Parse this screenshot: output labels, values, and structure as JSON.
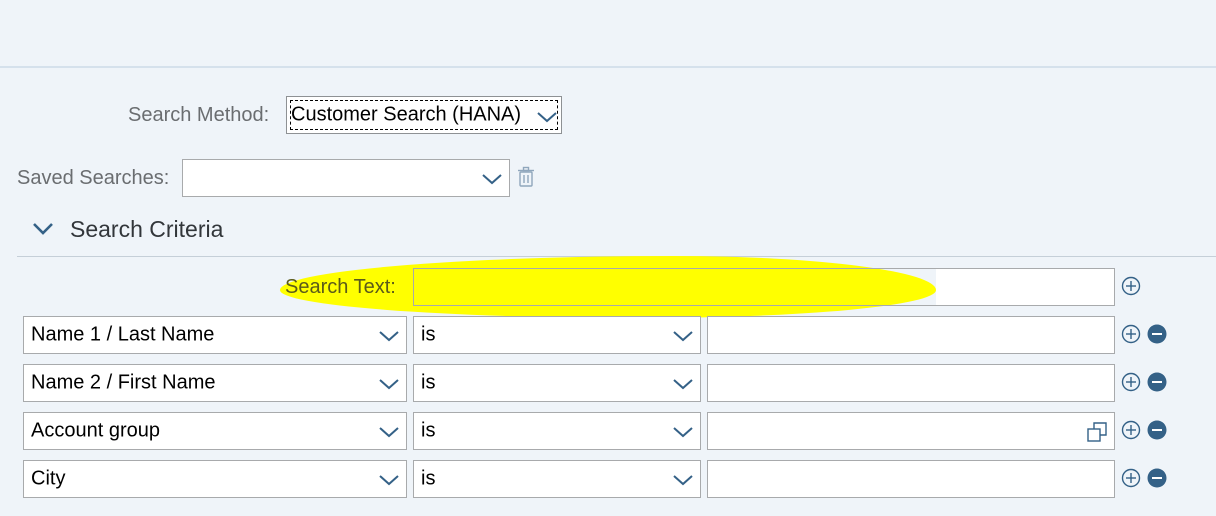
{
  "search_method": {
    "label": "Search Method:",
    "value": "Customer Search (HANA)"
  },
  "saved_searches": {
    "label": "Saved Searches:",
    "value": ""
  },
  "section": {
    "title": "Search Criteria"
  },
  "search_text": {
    "label": "Search Text:",
    "value": ""
  },
  "criteria": [
    {
      "field": "Name 1 / Last Name",
      "operator": "is",
      "value": ""
    },
    {
      "field": "Name 2 / First Name",
      "operator": "is",
      "value": ""
    },
    {
      "field": "Account group",
      "operator": "is",
      "value": ""
    },
    {
      "field": "City",
      "operator": "is",
      "value": ""
    }
  ],
  "icons": {
    "chevron": "chevron-down-icon",
    "delete": "trash-icon",
    "add": "add-circle-icon",
    "remove": "remove-circle-icon",
    "value_help": "value-help-icon"
  },
  "colors": {
    "accent": "#346187",
    "highlight": "#ffff00",
    "icon": "#346187"
  }
}
